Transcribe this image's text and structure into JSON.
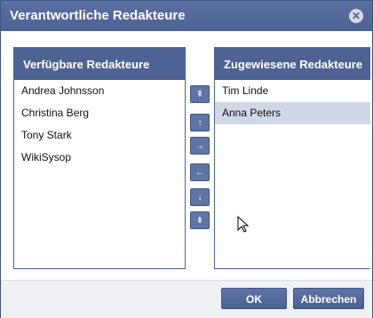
{
  "dialog": {
    "title": "Verantwortliche Redakteure",
    "close_icon": "close-icon"
  },
  "available": {
    "header": "Verfügbare Redakteure",
    "items": [
      "Andrea Johnsson",
      "Christina Berg",
      "Tony Stark",
      "WikiSysop"
    ]
  },
  "assigned": {
    "header": "Zugewiesene Redakteure",
    "items": [
      "Tim Linde",
      "Anna Peters"
    ],
    "selected_index": 1
  },
  "move_buttons": [
    {
      "icon": "move-top-icon",
      "glyph": "⇞"
    },
    {
      "icon": "move-up-icon",
      "glyph": "↑"
    },
    {
      "icon": "move-right-icon",
      "glyph": "→"
    },
    {
      "icon": "move-left-icon",
      "glyph": "←"
    },
    {
      "icon": "move-down-icon",
      "glyph": "↓"
    },
    {
      "icon": "move-bottom-icon",
      "glyph": "⇟"
    }
  ],
  "footer": {
    "ok_label": "OK",
    "cancel_label": "Abbrechen"
  },
  "colors": {
    "accent": "#4d6394",
    "selected_row": "#d1d8e6"
  }
}
